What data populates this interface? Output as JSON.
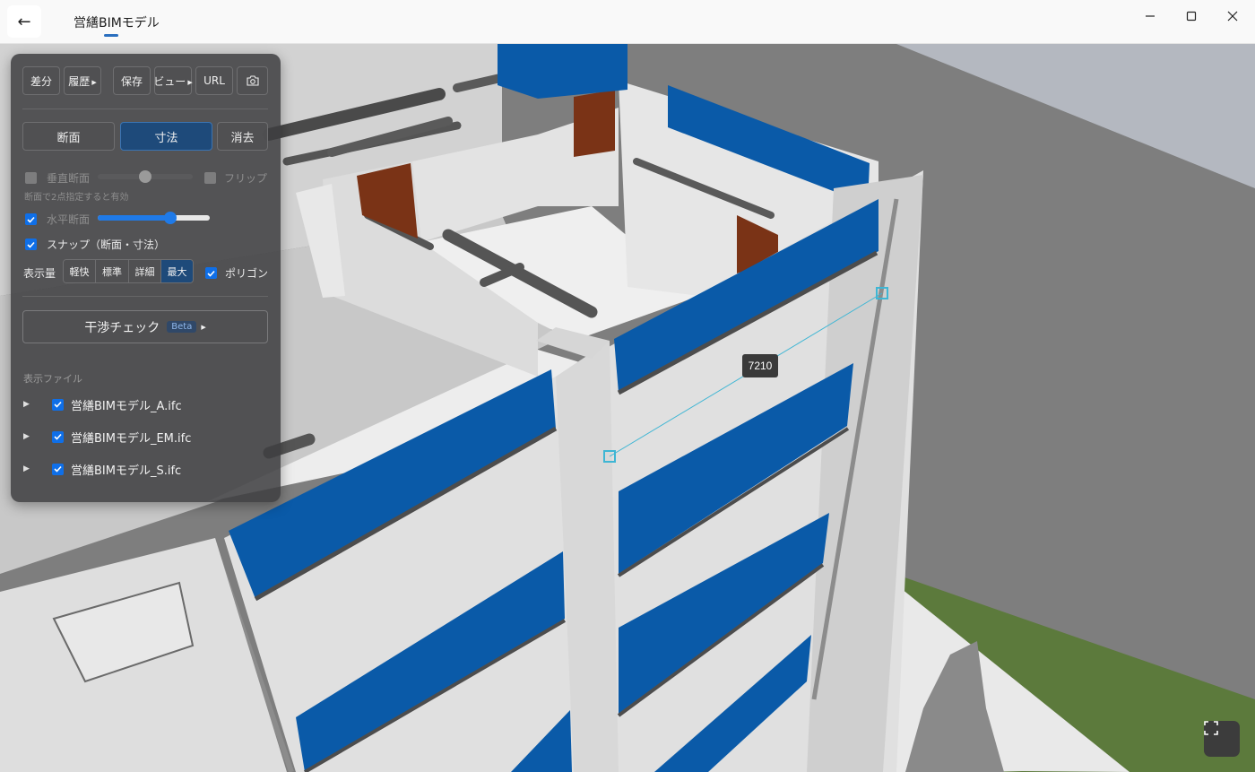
{
  "window": {
    "title": "営繕BIMモデル",
    "back_icon": "←"
  },
  "toolbar": {
    "diff_label": "差分",
    "history_label": "履歴",
    "save_label": "保存",
    "view_label": "ビュー",
    "url_label": "URL",
    "camera_icon": "camera-icon"
  },
  "modes": {
    "section_label": "断面",
    "measure_label": "寸法",
    "clear_label": "消去",
    "active": "寸法"
  },
  "options": {
    "vertical_section_label": "垂直断面",
    "vertical_section_checked": false,
    "vertical_section_level": 0.5,
    "flip_label": "フリップ",
    "flip_checked": false,
    "vertical_hint": "断面で2点指定すると有効",
    "horizontal_section_label": "水平断面",
    "horizontal_section_checked": true,
    "horizontal_section_level": 0.65,
    "snap_label": "スナップ（断面・寸法）",
    "snap_checked": true
  },
  "display": {
    "label": "表示量",
    "levels": [
      "軽快",
      "標準",
      "詳細",
      "最大"
    ],
    "selected": "最大",
    "polygon_label": "ポリゴン",
    "polygon_checked": true
  },
  "clash_check": {
    "label": "干渉チェック",
    "badge": "Beta"
  },
  "files": {
    "heading": "表示ファイル",
    "items": [
      {
        "name": "営繕BIMモデル_A.ifc",
        "checked": true
      },
      {
        "name": "営繕BIMモデル_EM.ifc",
        "checked": true
      },
      {
        "name": "営繕BIMモデル_S.ifc",
        "checked": true
      }
    ]
  },
  "measurement": {
    "value": "7210"
  },
  "colors": {
    "accent": "#0f6fe8",
    "glass_blue": "#0a5aa8",
    "door_brown": "#7a3316",
    "measure_line": "#3fb6d4"
  }
}
